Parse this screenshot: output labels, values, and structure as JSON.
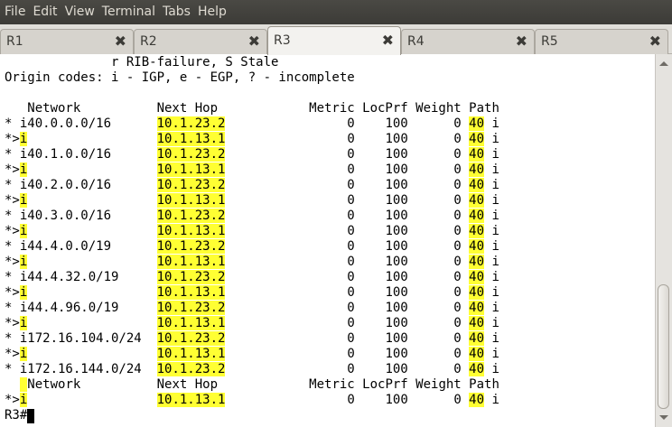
{
  "menubar": {
    "items": [
      "File",
      "Edit",
      "View",
      "Terminal",
      "Tabs",
      "Help"
    ]
  },
  "tabs": [
    {
      "label": "R1",
      "active": false
    },
    {
      "label": "R2",
      "active": false
    },
    {
      "label": "R3",
      "active": true
    },
    {
      "label": "R4",
      "active": false
    },
    {
      "label": "R5",
      "active": false
    }
  ],
  "close_glyph": "✖",
  "colors": {
    "highlight": "#ffff33",
    "menubar_bg": "#3c3b37"
  },
  "terminal": {
    "lines": [
      [
        {
          "t": "              r RIB-failure, S Stale"
        }
      ],
      [
        {
          "t": "Origin codes: i - IGP, e - EGP, ? - incomplete"
        }
      ],
      [
        {
          "t": ""
        }
      ],
      [
        {
          "t": "   Network          Next Hop            Metric LocPrf Weight Path"
        }
      ],
      [
        {
          "t": "* i40.0.0.0/16      "
        },
        {
          "t": "10.1.23.2",
          "hl": true
        },
        {
          "t": "                0    100      0 "
        },
        {
          "t": "40",
          "hl": true
        },
        {
          "t": " i"
        }
      ],
      [
        {
          "t": "*>"
        },
        {
          "t": "i",
          "hl": true
        },
        {
          "t": "                 "
        },
        {
          "t": "10.1.13.1",
          "hl": true
        },
        {
          "t": "                0    100      0 "
        },
        {
          "t": "40",
          "hl": true
        },
        {
          "t": " i"
        }
      ],
      [
        {
          "t": "* i40.1.0.0/16      "
        },
        {
          "t": "10.1.23.2",
          "hl": true
        },
        {
          "t": "                0    100      0 "
        },
        {
          "t": "40",
          "hl": true
        },
        {
          "t": " i"
        }
      ],
      [
        {
          "t": "*>"
        },
        {
          "t": "i",
          "hl": true
        },
        {
          "t": "                 "
        },
        {
          "t": "10.1.13.1",
          "hl": true
        },
        {
          "t": "                0    100      0 "
        },
        {
          "t": "40",
          "hl": true
        },
        {
          "t": " i"
        }
      ],
      [
        {
          "t": "* i40.2.0.0/16      "
        },
        {
          "t": "10.1.23.2",
          "hl": true
        },
        {
          "t": "                0    100      0 "
        },
        {
          "t": "40",
          "hl": true
        },
        {
          "t": " i"
        }
      ],
      [
        {
          "t": "*>"
        },
        {
          "t": "i",
          "hl": true
        },
        {
          "t": "                 "
        },
        {
          "t": "10.1.13.1",
          "hl": true
        },
        {
          "t": "                0    100      0 "
        },
        {
          "t": "40",
          "hl": true
        },
        {
          "t": " i"
        }
      ],
      [
        {
          "t": "* i40.3.0.0/16      "
        },
        {
          "t": "10.1.23.2",
          "hl": true
        },
        {
          "t": "                0    100      0 "
        },
        {
          "t": "40",
          "hl": true
        },
        {
          "t": " i"
        }
      ],
      [
        {
          "t": "*>"
        },
        {
          "t": "i",
          "hl": true
        },
        {
          "t": "                 "
        },
        {
          "t": "10.1.13.1",
          "hl": true
        },
        {
          "t": "                0    100      0 "
        },
        {
          "t": "40",
          "hl": true
        },
        {
          "t": " i"
        }
      ],
      [
        {
          "t": "* i44.4.0.0/19      "
        },
        {
          "t": "10.1.23.2",
          "hl": true
        },
        {
          "t": "                0    100      0 "
        },
        {
          "t": "40",
          "hl": true
        },
        {
          "t": " i"
        }
      ],
      [
        {
          "t": "*>"
        },
        {
          "t": "i",
          "hl": true
        },
        {
          "t": "                 "
        },
        {
          "t": "10.1.13.1",
          "hl": true
        },
        {
          "t": "                0    100      0 "
        },
        {
          "t": "40",
          "hl": true
        },
        {
          "t": " i"
        }
      ],
      [
        {
          "t": "* i44.4.32.0/19     "
        },
        {
          "t": "10.1.23.2",
          "hl": true
        },
        {
          "t": "                0    100      0 "
        },
        {
          "t": "40",
          "hl": true
        },
        {
          "t": " i"
        }
      ],
      [
        {
          "t": "*>"
        },
        {
          "t": "i",
          "hl": true
        },
        {
          "t": "                 "
        },
        {
          "t": "10.1.13.1",
          "hl": true
        },
        {
          "t": "                0    100      0 "
        },
        {
          "t": "40",
          "hl": true
        },
        {
          "t": " i"
        }
      ],
      [
        {
          "t": "* i44.4.96.0/19     "
        },
        {
          "t": "10.1.23.2",
          "hl": true
        },
        {
          "t": "                0    100      0 "
        },
        {
          "t": "40",
          "hl": true
        },
        {
          "t": " i"
        }
      ],
      [
        {
          "t": "*>"
        },
        {
          "t": "i",
          "hl": true
        },
        {
          "t": "                 "
        },
        {
          "t": "10.1.13.1",
          "hl": true
        },
        {
          "t": "                0    100      0 "
        },
        {
          "t": "40",
          "hl": true
        },
        {
          "t": " i"
        }
      ],
      [
        {
          "t": "* i172.16.104.0/24  "
        },
        {
          "t": "10.1.23.2",
          "hl": true
        },
        {
          "t": "                0    100      0 "
        },
        {
          "t": "40",
          "hl": true
        },
        {
          "t": " i"
        }
      ],
      [
        {
          "t": "*>"
        },
        {
          "t": "i",
          "hl": true
        },
        {
          "t": "                 "
        },
        {
          "t": "10.1.13.1",
          "hl": true
        },
        {
          "t": "                0    100      0 "
        },
        {
          "t": "40",
          "hl": true
        },
        {
          "t": " i"
        }
      ],
      [
        {
          "t": "* i172.16.144.0/24  "
        },
        {
          "t": "10.1.23.2",
          "hl": true
        },
        {
          "t": "                0    100      0 "
        },
        {
          "t": "40",
          "hl": true
        },
        {
          "t": " i"
        }
      ],
      [
        {
          "t": "  "
        },
        {
          "t": " ",
          "hl": true
        },
        {
          "t": "Network          Next Hop            Metric LocPrf Weight Path"
        }
      ],
      [
        {
          "t": "*>"
        },
        {
          "t": "i",
          "hl": true
        },
        {
          "t": "                 "
        },
        {
          "t": "10.1.13.1",
          "hl": true
        },
        {
          "t": "                0    100      0 "
        },
        {
          "t": "40",
          "hl": true
        },
        {
          "t": " i"
        }
      ],
      [
        {
          "t": "R3#"
        },
        {
          "t": "",
          "cursor": true
        }
      ]
    ]
  }
}
